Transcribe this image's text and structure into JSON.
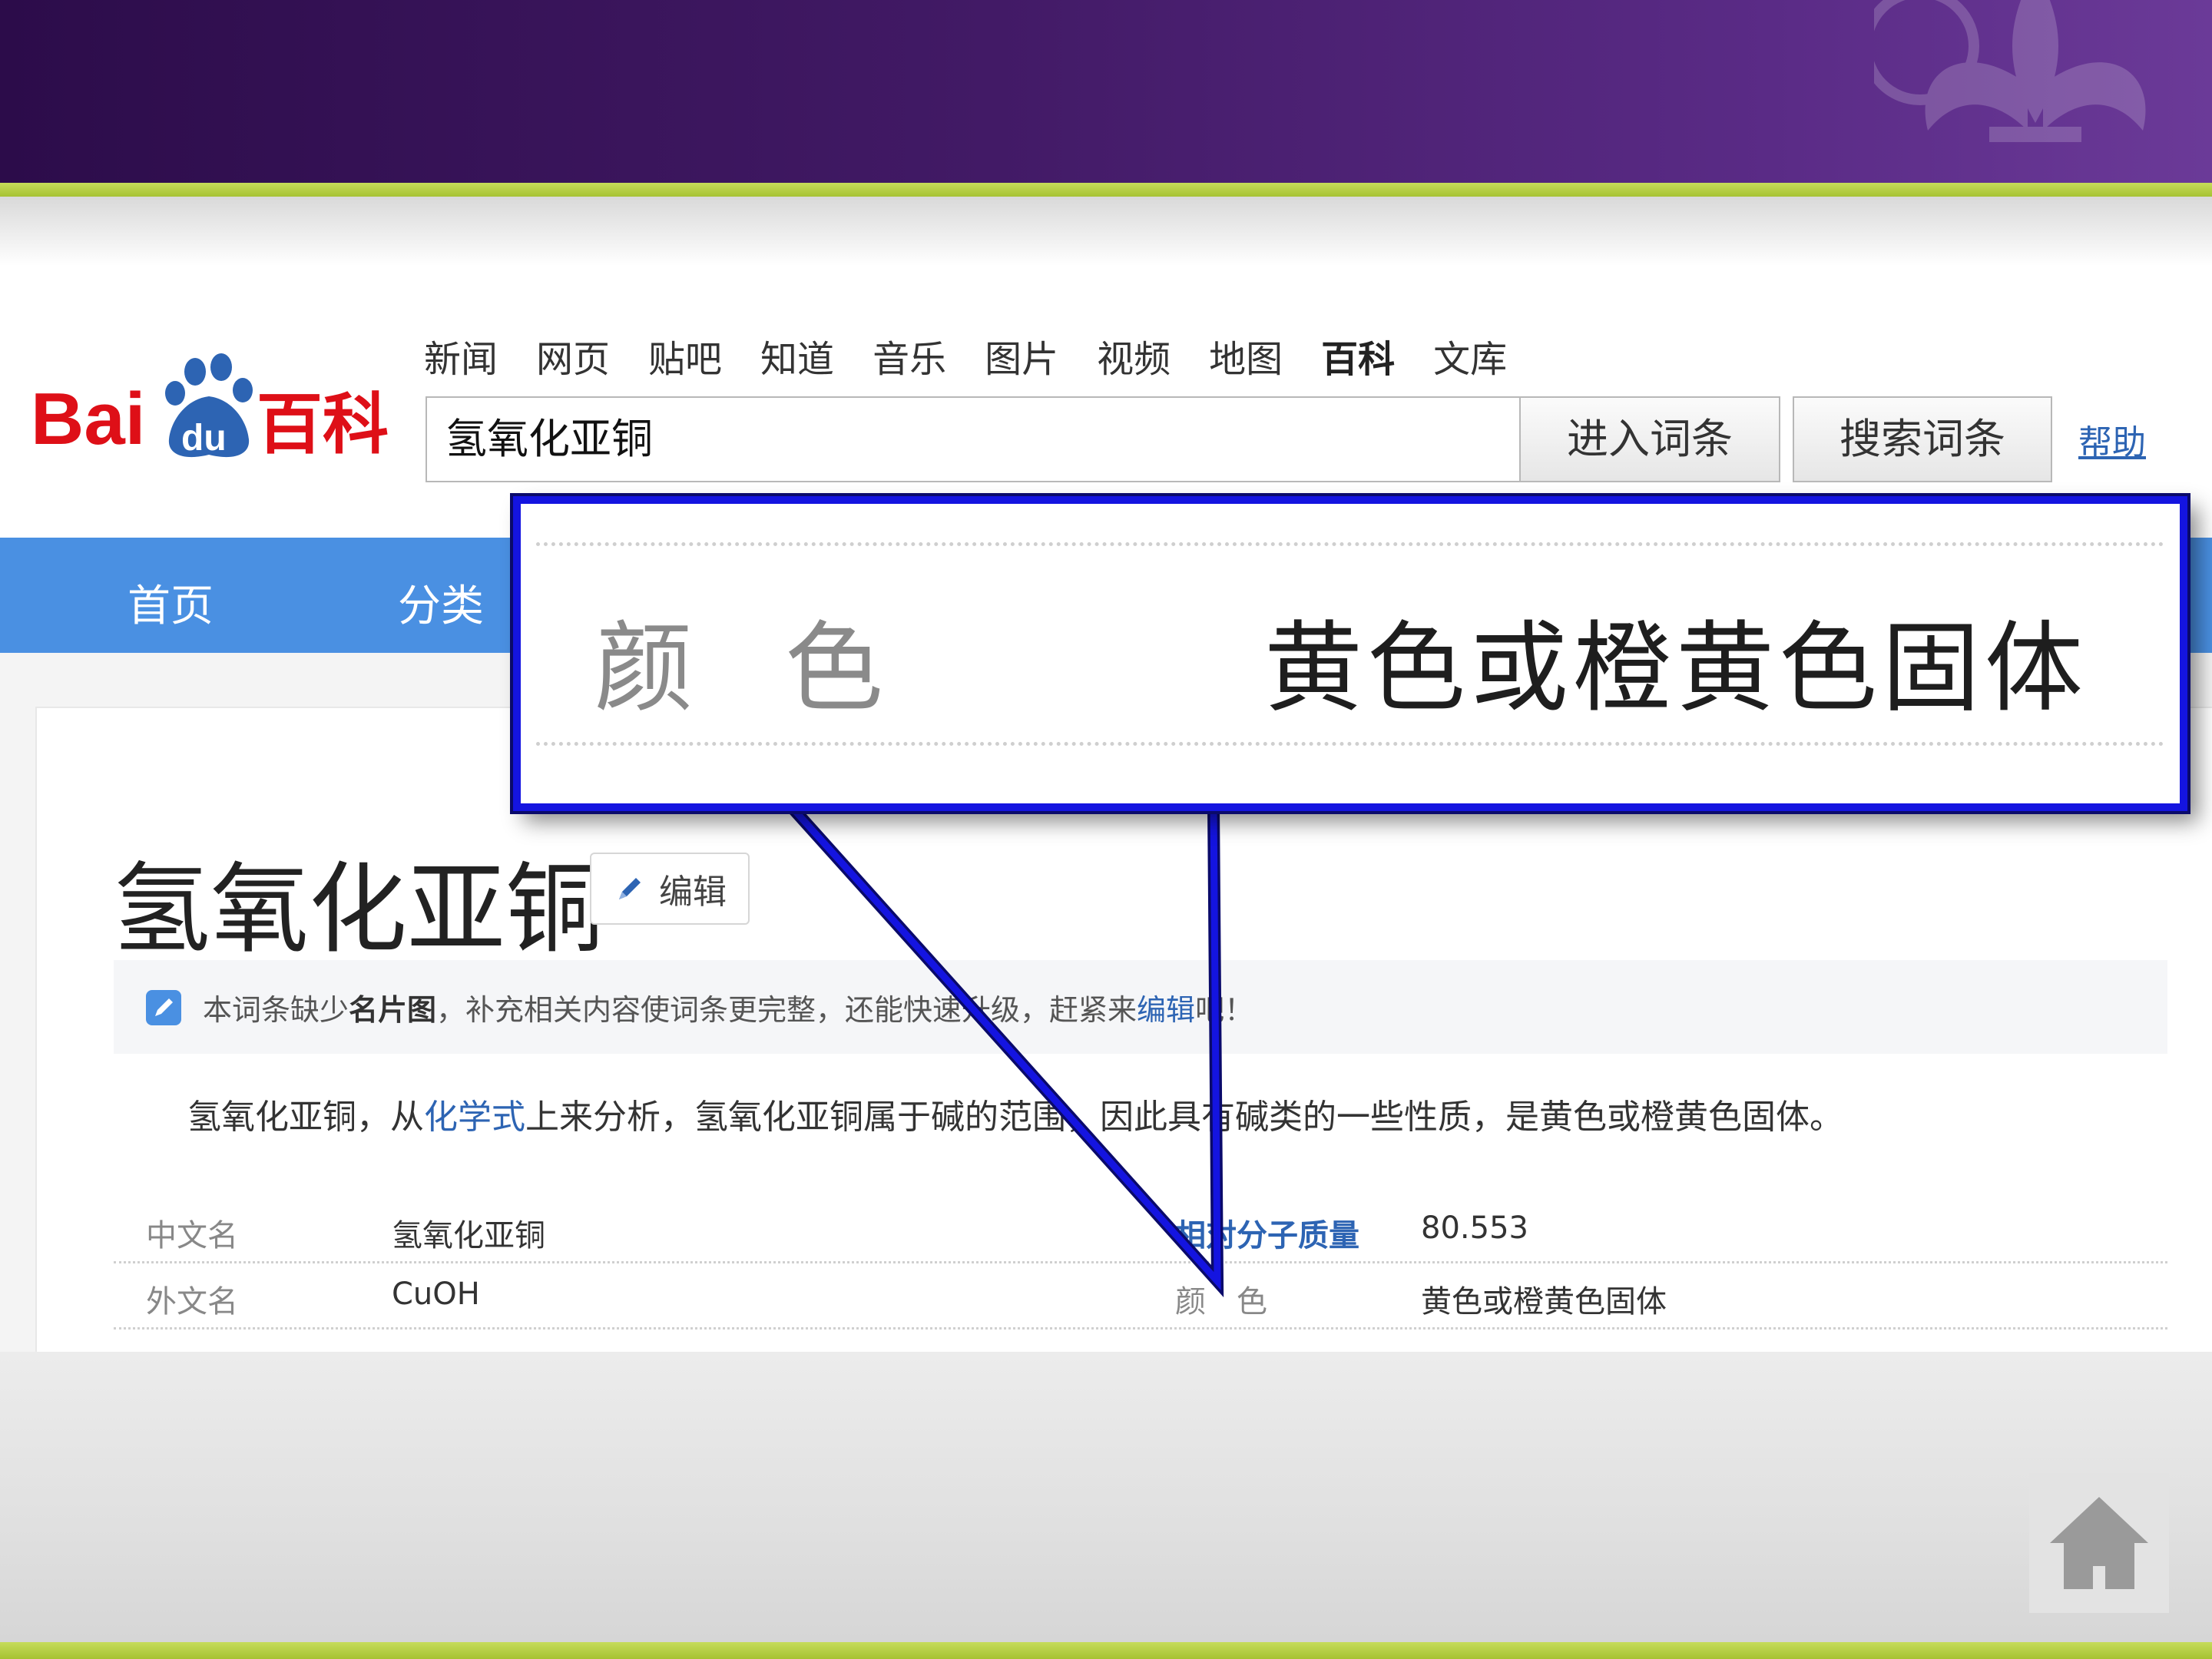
{
  "header_nav": {
    "links": [
      "新闻",
      "网页",
      "贴吧",
      "知道",
      "音乐",
      "图片",
      "视频",
      "地图",
      "百科",
      "文库"
    ],
    "active": "百科"
  },
  "logo": {
    "text_bai": "Bai",
    "text_du": "du",
    "text_baike": "百科"
  },
  "search": {
    "value": "氢氧化亚铜",
    "enter_button": "进入词条",
    "search_button": "搜索词条",
    "help_link": "帮助"
  },
  "blue_nav": {
    "home": "首页",
    "category": "分类"
  },
  "article": {
    "title": "氢氧化亚铜",
    "edit_button": "编辑",
    "notice": {
      "part1": "本词条缺少",
      "bold": "名片图",
      "part2": "，补充相关内容使词条更完整，还能快速升级，赶紧来",
      "link": "编辑",
      "part3": "吧！"
    },
    "summary": {
      "part1": "氢氧化亚铜，从",
      "link": "化学式",
      "part2": "上来分析，氢氧化亚铜属于碱的范围，因此具有碱类的一些性质，是黄色或橙黄色固体。"
    },
    "infobox": [
      {
        "key1": "中文名",
        "val1": "氢氧化亚铜",
        "key2": "相对分子质量",
        "val2": "80.553"
      },
      {
        "key1": "外文名",
        "val1": "CuOH",
        "key2": "颜　色",
        "val2": "黄色或橙黄色固体"
      }
    ]
  },
  "callout": {
    "label": "颜色",
    "value": "黄色或橙黄色固体"
  },
  "colors": {
    "banner": "#421a66",
    "accent_green": "#a6c232",
    "baidu_red": "#de0f17",
    "baidu_blue": "#2d64b3",
    "nav_blue": "#4a90e2",
    "callout_border": "#1414e0"
  },
  "icons": {
    "edit": "pencil-icon",
    "notice": "edit-note-icon",
    "home": "house-icon",
    "logo_paw": "paw-icon"
  }
}
